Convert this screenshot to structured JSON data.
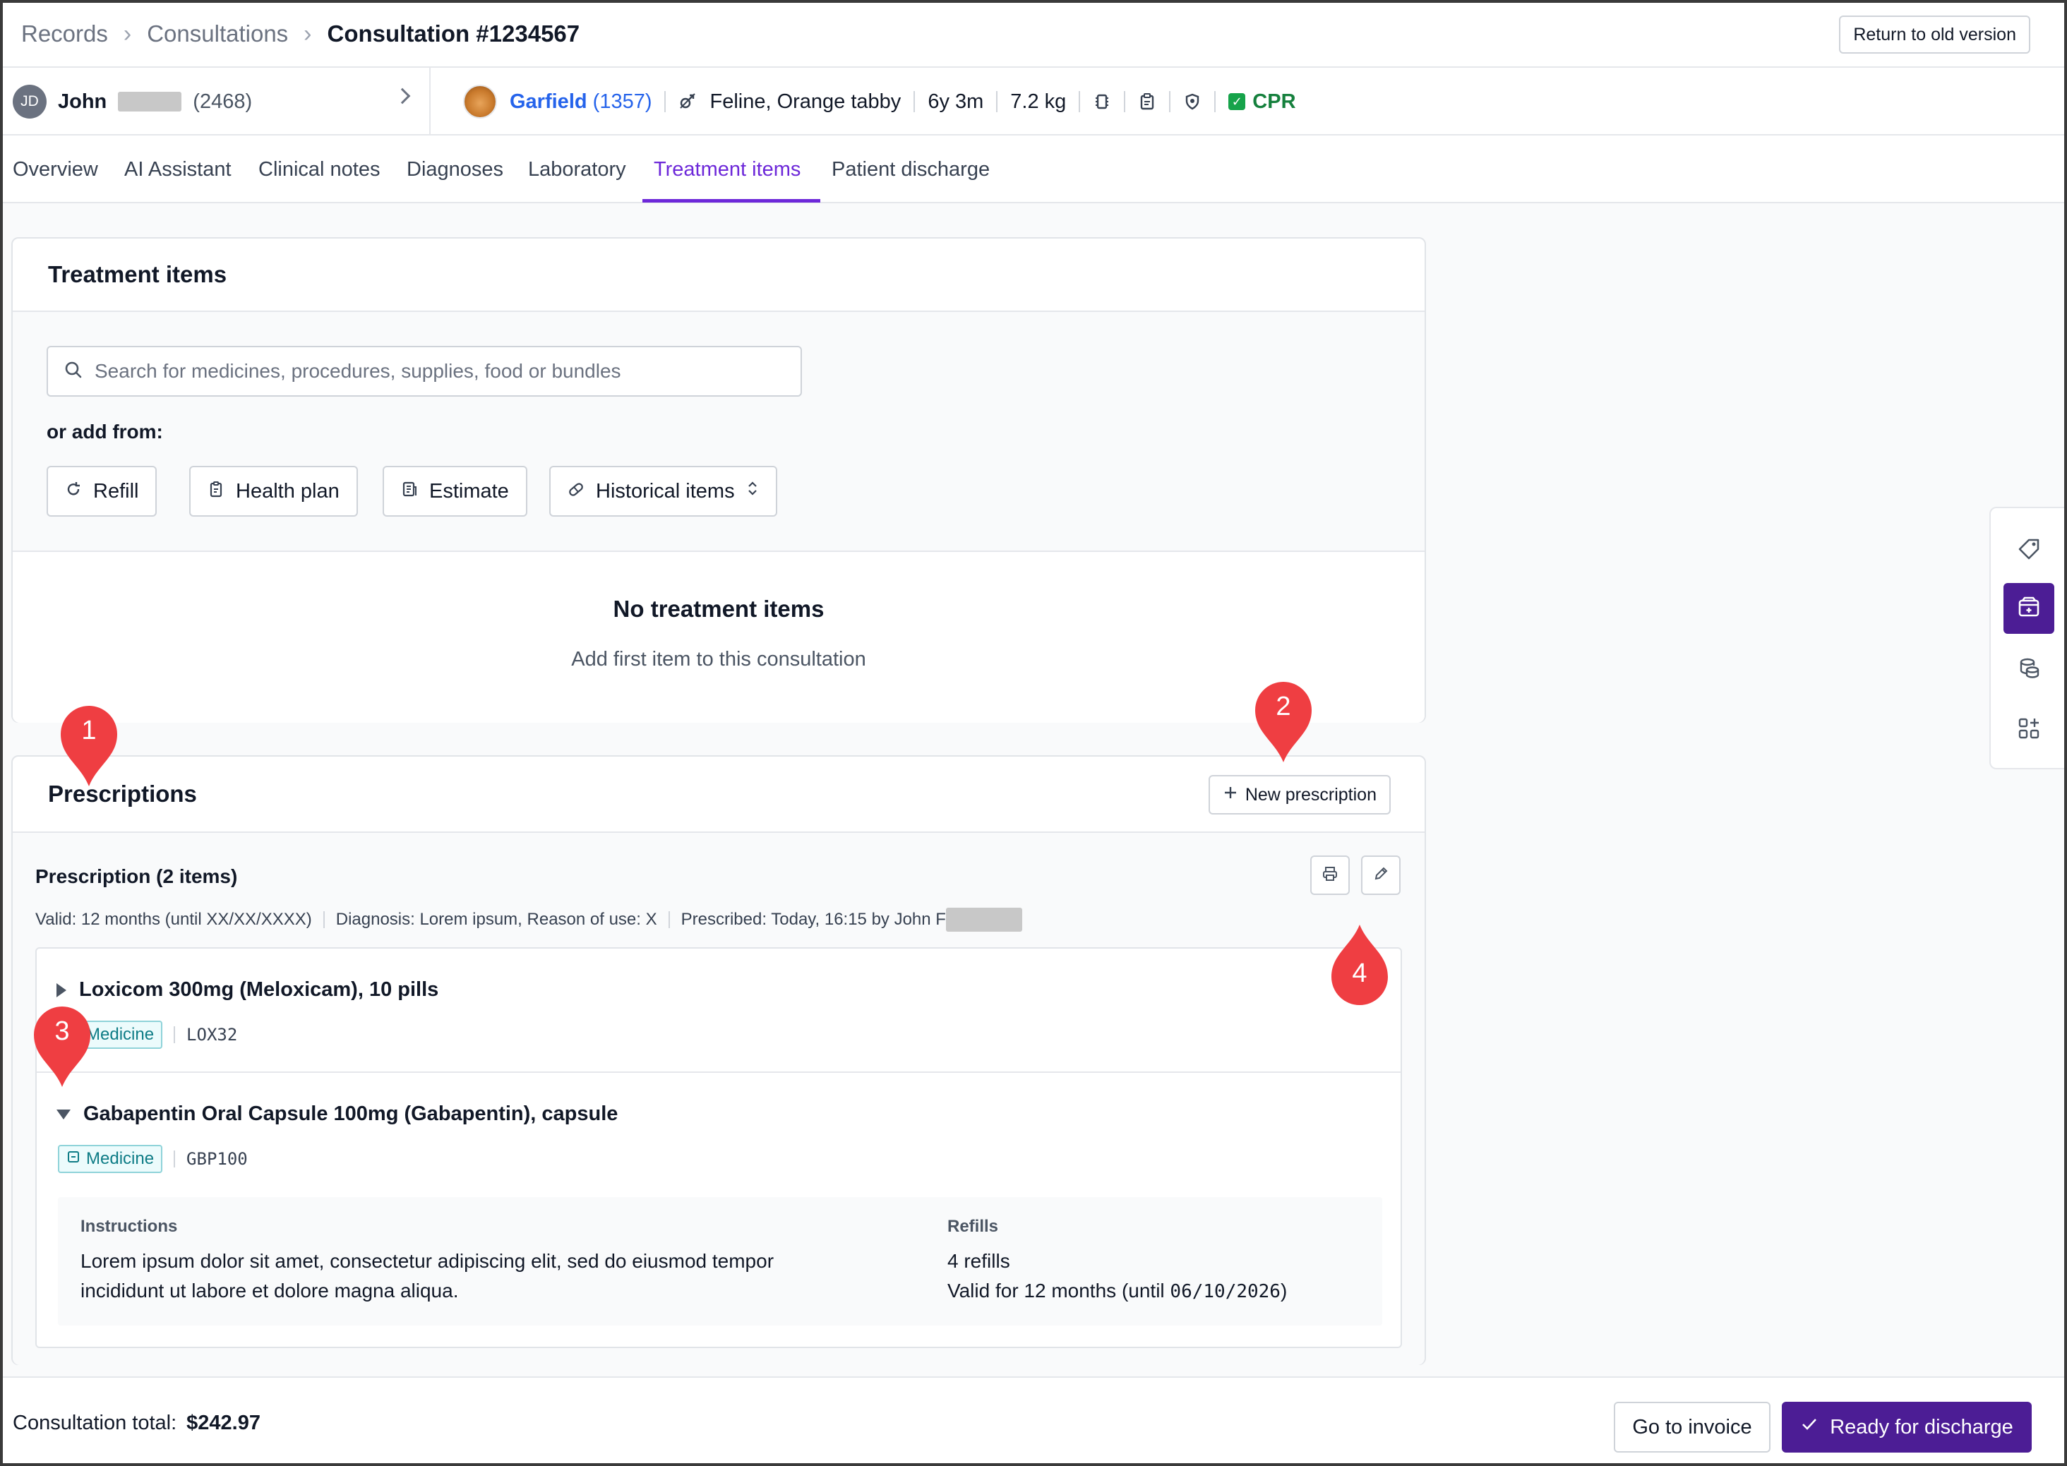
{
  "breadcrumb": {
    "items": [
      "Records",
      "Consultations"
    ],
    "current": "Consultation #1234567"
  },
  "header": {
    "old_version_label": "Return to old version"
  },
  "client": {
    "initials": "JD",
    "first_name": "John",
    "id": "(2468)"
  },
  "patient": {
    "name": "Garfield",
    "id": "(1357)",
    "species": "Feline, Orange tabby",
    "age": "6y 3m",
    "weight": "7.2 kg",
    "cpr_label": "CPR"
  },
  "tabs": [
    {
      "label": "Overview"
    },
    {
      "label": "AI Assistant"
    },
    {
      "label": "Clinical notes"
    },
    {
      "label": "Diagnoses"
    },
    {
      "label": "Laboratory"
    },
    {
      "label": "Treatment items",
      "active": true
    },
    {
      "label": "Patient discharge"
    }
  ],
  "treatment": {
    "title": "Treatment items",
    "search_placeholder": "Search for medicines, procedures, supplies, food or bundles",
    "or_add_label": "or add from:",
    "sources": [
      "Refill",
      "Health plan",
      "Estimate",
      "Historical items"
    ],
    "empty_title": "No treatment items",
    "empty_subtitle": "Add first item to this consultation"
  },
  "prescriptions": {
    "title": "Prescriptions",
    "new_label": "New prescription",
    "header_title": "Prescription (2 items)",
    "meta": {
      "valid": "Valid: 12 months (until XX/XX/XXXX)",
      "diagnosis": "Diagnosis: Lorem ipsum, Reason of use: X",
      "prescribed": "Prescribed: Today, 16:15 by John F"
    },
    "items": [
      {
        "name": "Loxicom 300mg (Meloxicam), 10 pills",
        "tag": "Medicine",
        "code": "LOX32",
        "expanded": false
      },
      {
        "name": "Gabapentin Oral Capsule 100mg (Gabapentin), capsule",
        "tag": "Medicine",
        "code": "GBP100",
        "expanded": true,
        "instructions_label": "Instructions",
        "instructions_line1": "Lorem ipsum dolor sit amet, consectetur adipiscing elit, sed do eiusmod tempor",
        "instructions_line2": "incididunt ut labore et dolore magna aliqua.",
        "refills_label": "Refills",
        "refills_count": "4 refills",
        "refills_valid_prefix": "Valid for 12 months (until ",
        "refills_valid_date": "06/10/2026",
        "refills_valid_suffix": ")"
      }
    ]
  },
  "footer": {
    "total_label": "Consultation total:",
    "total_value": "$242.97",
    "invoice_label": "Go to invoice",
    "discharge_label": "Ready for discharge"
  },
  "markers": [
    "1",
    "2",
    "3",
    "4"
  ],
  "colors": {
    "accent": "#6d28d9",
    "primary_button": "#4c1d95",
    "link": "#2563eb",
    "cpr_green": "#15803d",
    "tag_teal": "#0e7c86",
    "marker_red": "#ef3e42"
  },
  "icons": {
    "breadcrumb_separator": "chevron-right-icon",
    "search": "search-icon",
    "refill": "refresh-icon",
    "health_plan": "clipboard-icon",
    "estimate": "document-icon",
    "historical": "pill-icon",
    "print": "printer-icon",
    "edit": "pencil-icon",
    "rail": [
      "tag-icon",
      "inventory-box-icon",
      "coins-icon",
      "apps-icon"
    ]
  }
}
